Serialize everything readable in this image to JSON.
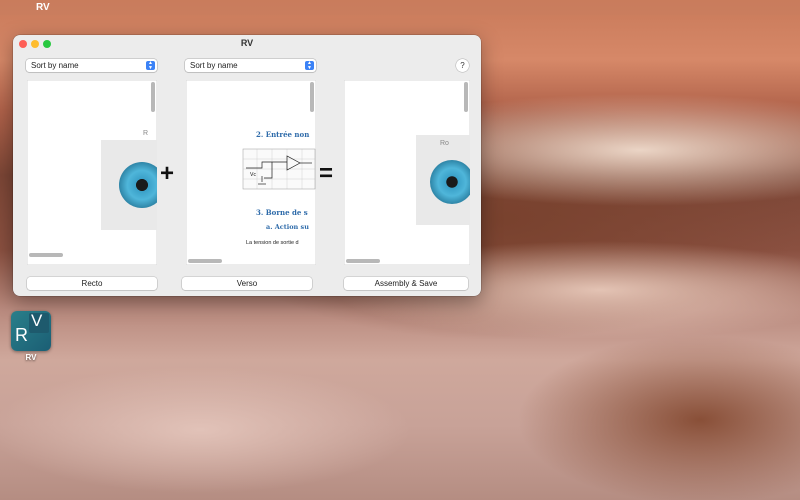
{
  "menubar": {
    "apple": "",
    "app_name": "RV"
  },
  "window": {
    "title": "RV",
    "sort_recto": "Sort by name",
    "sort_verso": "Sort by name",
    "help": "?",
    "plus": "+",
    "equals": "=",
    "recto_label": "Recto",
    "verso_label": "Verso",
    "save_label": "Assembly & Save",
    "recto_corner_text": "R",
    "output_corner_text": "Ro",
    "verso_doc": {
      "heading1": "2.  Entrée non",
      "heading2": "3.  Borne de s",
      "heading3": "a.  Action su",
      "body": "La tension de sortie d"
    }
  },
  "desktop_icon": {
    "label": "RV",
    "letter_r": "R",
    "letter_v": "V"
  }
}
